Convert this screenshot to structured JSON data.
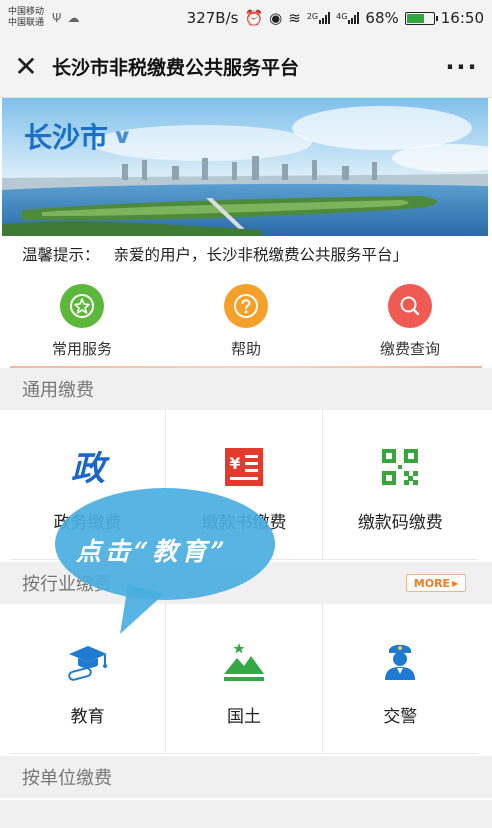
{
  "status_bar": {
    "carrier_1": "中国移动",
    "carrier_2": "中国联通",
    "net_speed": "327B/s",
    "signal_1": "2G",
    "signal_2": "4G",
    "battery": "68%",
    "battery_level": 0.68,
    "time": "16:50"
  },
  "title_bar": {
    "close_icon": "close-icon",
    "title": "长沙市非税缴费公共服务平台",
    "more_icon": "more-dots-icon"
  },
  "banner": {
    "city": "长沙市",
    "dropdown_icon": "chevron-down-icon"
  },
  "notice": {
    "label": "温馨提示：",
    "text": "亲爱的用户，长沙非税缴费公共服务平台」"
  },
  "quick_entries": [
    {
      "label": "常用服务",
      "icon": "star-icon",
      "color": "#5cb83a"
    },
    {
      "label": "帮助",
      "icon": "question-icon",
      "color": "#f5a02a"
    },
    {
      "label": "缴费查询",
      "icon": "search-icon",
      "color": "#ef5a52"
    }
  ],
  "sections": {
    "general": {
      "title": "通用缴费",
      "items": [
        {
          "label": "政务缴费",
          "icon": "zheng-icon",
          "color": "#1c66c8"
        },
        {
          "label": "缴款书缴费",
          "icon": "receipt-icon",
          "color": "#e23a2c"
        },
        {
          "label": "缴款码缴费",
          "icon": "qr-code-icon",
          "color": "#3aa53a"
        }
      ]
    },
    "industry": {
      "title": "按行业缴费",
      "more": "MORE",
      "items": [
        {
          "label": "教育",
          "icon": "graduation-cap-icon",
          "color": "#1e7bd1"
        },
        {
          "label": "国土",
          "icon": "mountain-icon",
          "color": "#33a845"
        },
        {
          "label": "交警",
          "icon": "police-icon",
          "color": "#1e7bd1"
        }
      ]
    },
    "unit": {
      "title": "按单位缴费"
    }
  },
  "annotation": {
    "text": "点击“教育”"
  }
}
